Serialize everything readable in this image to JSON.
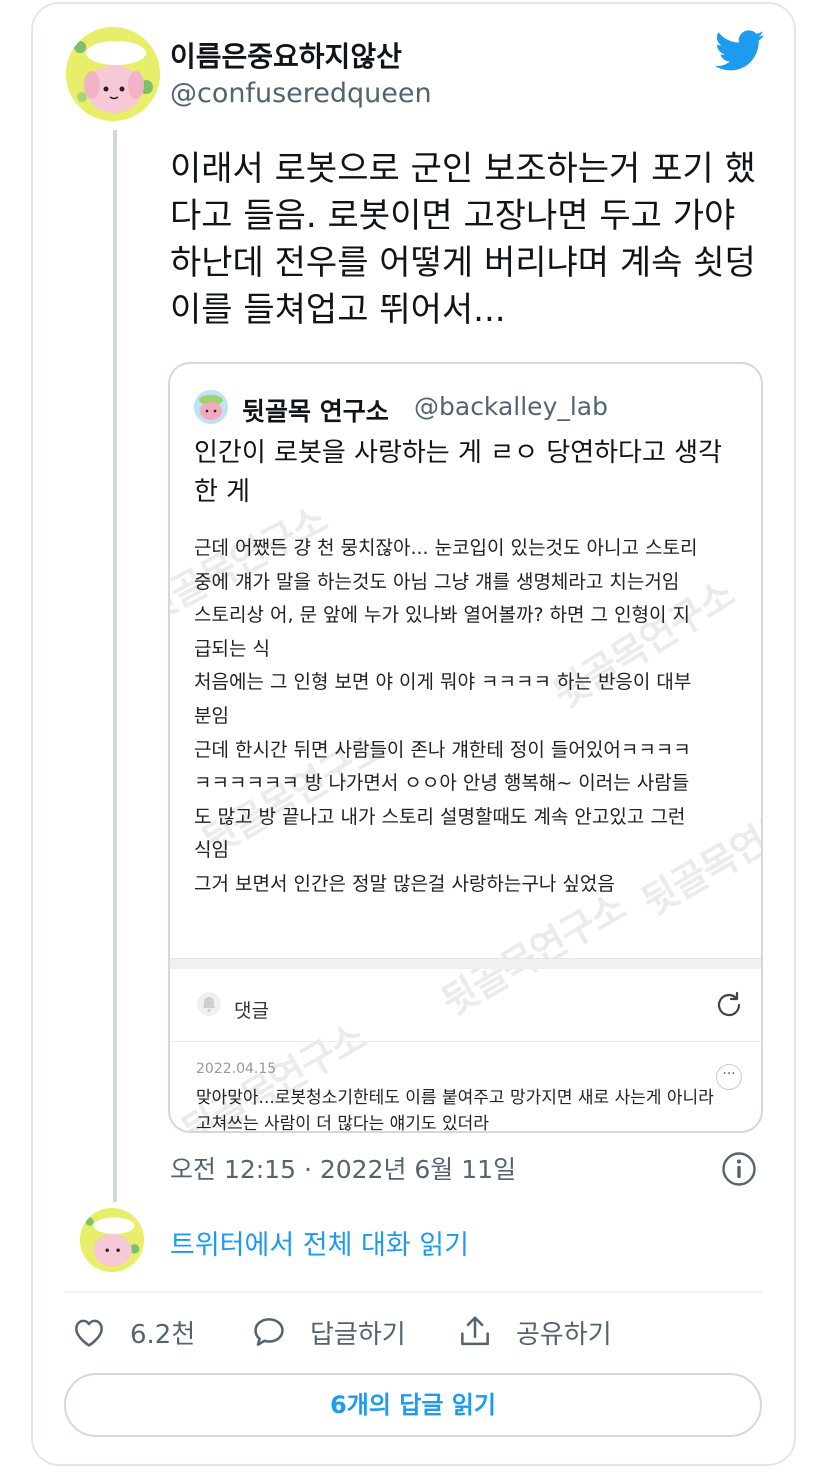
{
  "tweet": {
    "author_name": "이름은중요하지않산",
    "author_handle": "@confuseredqueen",
    "text": "이래서 로봇으로 군인 보조하는거 포기 했다고 들음. 로봇이면 고장나면 두고 가야 하난데 전우를 어떻게 버리냐며 계속 쇳덩이를 들쳐업고 뛰어서...",
    "timestamp": "오전 12:15 · 2022년 6월 11일"
  },
  "quote": {
    "author_name": "뒷골목 연구소",
    "author_handle": "@backalley_lab",
    "text": "인간이 로봇을 사랑하는 게 ㄹㅇ 당연하다고 생각한 게",
    "image": {
      "watermark": "뒷골목연구소",
      "body_lines": [
        "근데 어쨌든 걍 천 뭉치잖아... 눈코입이 있는것도 아니고 스토리",
        "중에 걔가 말을 하는것도 아님 그냥 걔를 생명체라고 치는거임",
        "스토리상 어, 문 앞에 누가 있나봐 열어볼까? 하면 그 인형이 지",
        "급되는 식",
        "처음에는 그 인형 보면 야 이게 뭐야 ㅋㅋㅋㅋ 하는 반응이 대부",
        "분임",
        "근데 한시간 뒤면 사람들이 존나 걔한테 정이 들어있어ㅋㅋㅋㅋ",
        "ㅋㅋㅋㅋㅋㅋ 방 나가면서 ㅇㅇ아 안녕 행복해~ 이러는 사람들",
        "도 많고 방 끝나고 내가 스토리 설명할때도 계속 안고있고 그런",
        "식임",
        "그거 보면서 인간은 정말 많은걸 사랑하는구나 싶었음"
      ],
      "comment_label": "댓글",
      "comment_date": "2022.04.15",
      "comment_text": "맞아맞아...로봇청소기한테도 이름 붙여주고 망가지면 새로 사는게 아니라 고쳐쓰는 사람이 더 많다는 얘기도 있더라",
      "more_label": "···"
    }
  },
  "conversation_link": "트위터에서 전체 대화 읽기",
  "actions": {
    "like_count": "6.2천",
    "reply_label": "답글하기",
    "share_label": "공유하기"
  },
  "read_replies_label": "6개의 답글 읽기",
  "colors": {
    "accent": "#1d9bf0",
    "text": "#0f1419",
    "secondary": "#536471",
    "border": "#cfd9de"
  },
  "icons": [
    "twitter-bird-icon",
    "info-icon",
    "heart-icon",
    "reply-bubble-icon",
    "share-icon",
    "bell-icon",
    "refresh-icon"
  ]
}
